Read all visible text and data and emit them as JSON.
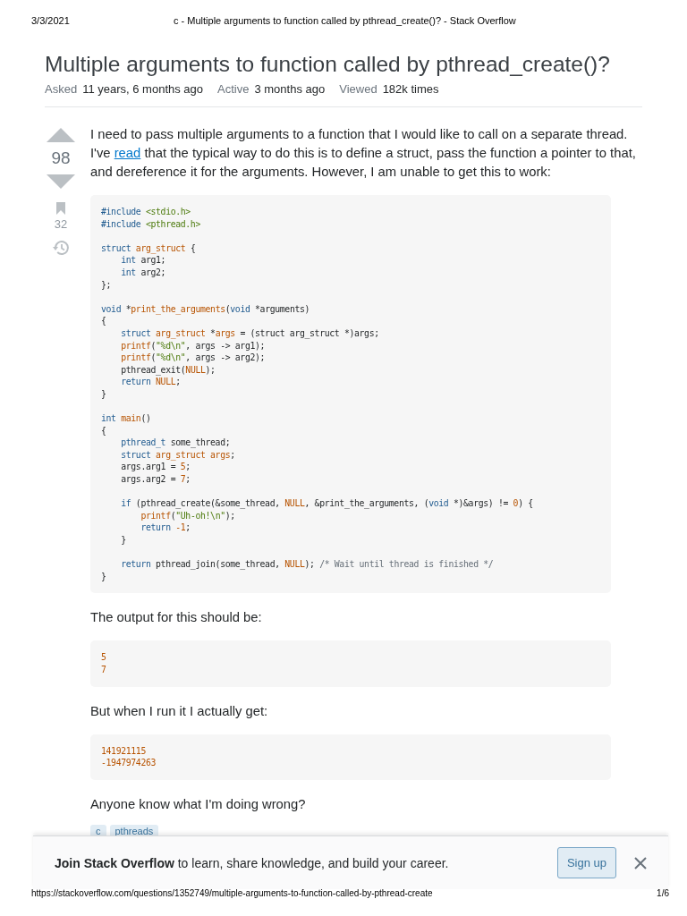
{
  "print_header": {
    "date": "3/3/2021",
    "page_title": "c - Multiple arguments to function called by pthread_create()? - Stack Overflow"
  },
  "question": {
    "title": "Multiple arguments to function called by pthread_create()?",
    "meta": [
      {
        "label": "Asked",
        "value": "11 years, 6 months ago"
      },
      {
        "label": "Active",
        "value": "3 months ago"
      },
      {
        "label": "Viewed",
        "value": "182k times"
      }
    ],
    "votes": "98",
    "bookmarks": "32",
    "body": [
      {
        "kind": "paragraph",
        "parts": [
          {
            "text": "I need to pass multiple arguments to a function that I would like to call on a separate thread. I've "
          },
          {
            "text": "read",
            "link": true
          },
          {
            "text": " that the typical way to do this is to define a struct, pass the function a pointer to that, and dereference it for the arguments. However, I am unable to get this to work:"
          }
        ]
      },
      {
        "kind": "code",
        "lines": [
          {
            "kind": "code",
            "tokens": [
              {
                "kind": "keyword",
                "text": "#include"
              },
              {
                "kind": "string",
                "text": " <stdio.h>"
              }
            ]
          },
          {
            "kind": "code",
            "tokens": [
              {
                "kind": "keyword",
                "text": "#include"
              },
              {
                "kind": "string",
                "text": " <pthread.h>"
              }
            ]
          },
          {
            "kind": "blank"
          },
          {
            "kind": "code",
            "tokens": [
              {
                "kind": "keyword",
                "text": "struct"
              },
              {
                "kind": "name",
                "text": " arg_struct"
              },
              {
                "kind": "plain",
                "text": " {"
              }
            ]
          },
          {
            "kind": "code",
            "tokens": [
              {
                "kind": "keyword",
                "text": "    int"
              },
              {
                "kind": "plain",
                "text": " arg1;"
              }
            ]
          },
          {
            "kind": "code",
            "tokens": [
              {
                "kind": "keyword",
                "text": "    int"
              },
              {
                "kind": "plain",
                "text": " arg2;"
              }
            ]
          },
          {
            "kind": "code",
            "tokens": [
              {
                "kind": "plain",
                "text": "};"
              }
            ]
          },
          {
            "kind": "blank"
          },
          {
            "kind": "code",
            "tokens": [
              {
                "kind": "keyword",
                "text": "void"
              },
              {
                "kind": "plain",
                "text": " *"
              },
              {
                "kind": "name",
                "text": "print_the_arguments"
              },
              {
                "kind": "plain",
                "text": "("
              },
              {
                "kind": "keyword",
                "text": "void"
              },
              {
                "kind": "plain",
                "text": " *arguments)"
              }
            ]
          },
          {
            "kind": "code",
            "tokens": [
              {
                "kind": "plain",
                "text": "{"
              }
            ]
          },
          {
            "kind": "code",
            "tokens": [
              {
                "kind": "keyword",
                "text": "    struct"
              },
              {
                "kind": "name",
                "text": " arg_struct"
              },
              {
                "kind": "plain",
                "text": " *"
              },
              {
                "kind": "name",
                "text": "args"
              },
              {
                "kind": "plain",
                "text": " = (struct arg_struct *)args;"
              }
            ]
          },
          {
            "kind": "code",
            "tokens": [
              {
                "kind": "name",
                "text": "    printf"
              },
              {
                "kind": "plain",
                "text": "("
              },
              {
                "kind": "string",
                "text": "\"%d\\n\""
              },
              {
                "kind": "plain",
                "text": ", args -> arg1);"
              }
            ]
          },
          {
            "kind": "code",
            "tokens": [
              {
                "kind": "name",
                "text": "    printf"
              },
              {
                "kind": "plain",
                "text": "("
              },
              {
                "kind": "string",
                "text": "\"%d\\n\""
              },
              {
                "kind": "plain",
                "text": ", args -> arg2);"
              }
            ]
          },
          {
            "kind": "code",
            "tokens": [
              {
                "kind": "plain",
                "text": "    pthread_exit("
              },
              {
                "kind": "name",
                "text": "NULL"
              },
              {
                "kind": "plain",
                "text": ");"
              }
            ]
          },
          {
            "kind": "code",
            "tokens": [
              {
                "kind": "keyword",
                "text": "    return"
              },
              {
                "kind": "name",
                "text": " NULL"
              },
              {
                "kind": "plain",
                "text": ";"
              }
            ]
          },
          {
            "kind": "code",
            "tokens": [
              {
                "kind": "plain",
                "text": "}"
              }
            ]
          },
          {
            "kind": "blank"
          },
          {
            "kind": "code",
            "tokens": [
              {
                "kind": "keyword",
                "text": "int"
              },
              {
                "kind": "name",
                "text": " main"
              },
              {
                "kind": "plain",
                "text": "()"
              }
            ]
          },
          {
            "kind": "code",
            "tokens": [
              {
                "kind": "plain",
                "text": "{"
              }
            ]
          },
          {
            "kind": "code",
            "tokens": [
              {
                "kind": "keyword",
                "text": "    pthread_t"
              },
              {
                "kind": "plain",
                "text": " some_thread;"
              }
            ]
          },
          {
            "kind": "code",
            "tokens": [
              {
                "kind": "keyword",
                "text": "    struct"
              },
              {
                "kind": "name",
                "text": " arg_struct"
              },
              {
                "kind": "name",
                "text": " args"
              },
              {
                "kind": "plain",
                "text": ";"
              }
            ]
          },
          {
            "kind": "code",
            "tokens": [
              {
                "kind": "plain",
                "text": "    args.arg1 = "
              },
              {
                "kind": "number",
                "text": "5"
              },
              {
                "kind": "plain",
                "text": ";"
              }
            ]
          },
          {
            "kind": "code",
            "tokens": [
              {
                "kind": "plain",
                "text": "    args.arg2 = "
              },
              {
                "kind": "number",
                "text": "7"
              },
              {
                "kind": "plain",
                "text": ";"
              }
            ]
          },
          {
            "kind": "blank"
          },
          {
            "kind": "code",
            "tokens": [
              {
                "kind": "keyword",
                "text": "    if"
              },
              {
                "kind": "plain",
                "text": " (pthread_create(&some_thread, "
              },
              {
                "kind": "name",
                "text": "NULL"
              },
              {
                "kind": "plain",
                "text": ", &print_the_arguments, ("
              },
              {
                "kind": "keyword",
                "text": "void"
              },
              {
                "kind": "plain",
                "text": " *)&args) != "
              },
              {
                "kind": "number",
                "text": "0"
              },
              {
                "kind": "plain",
                "text": ") {"
              }
            ]
          },
          {
            "kind": "code",
            "tokens": [
              {
                "kind": "name",
                "text": "        printf"
              },
              {
                "kind": "plain",
                "text": "("
              },
              {
                "kind": "string",
                "text": "\"Uh-oh!\\n\""
              },
              {
                "kind": "plain",
                "text": ");"
              }
            ]
          },
          {
            "kind": "code",
            "tokens": [
              {
                "kind": "keyword",
                "text": "        return"
              },
              {
                "kind": "number",
                "text": " -1"
              },
              {
                "kind": "plain",
                "text": ";"
              }
            ]
          },
          {
            "kind": "code",
            "tokens": [
              {
                "kind": "plain",
                "text": "    }"
              }
            ]
          },
          {
            "kind": "blank"
          },
          {
            "kind": "code",
            "tokens": [
              {
                "kind": "keyword",
                "text": "    return"
              },
              {
                "kind": "plain",
                "text": " pthread_join(some_thread, "
              },
              {
                "kind": "name",
                "text": "NULL"
              },
              {
                "kind": "plain",
                "text": "); "
              },
              {
                "kind": "comment",
                "text": "/* Wait until thread is finished */"
              }
            ]
          },
          {
            "kind": "code",
            "tokens": [
              {
                "kind": "plain",
                "text": "}"
              }
            ]
          }
        ]
      },
      {
        "kind": "paragraph",
        "parts": [
          {
            "text": "The output for this should be:"
          }
        ]
      },
      {
        "kind": "code",
        "lines": [
          {
            "kind": "code",
            "tokens": [
              {
                "kind": "number",
                "text": "5"
              }
            ]
          },
          {
            "kind": "code",
            "tokens": [
              {
                "kind": "number",
                "text": "7"
              }
            ]
          }
        ]
      },
      {
        "kind": "paragraph",
        "parts": [
          {
            "text": "But when I run it I actually get:"
          }
        ]
      },
      {
        "kind": "code",
        "lines": [
          {
            "kind": "code",
            "tokens": [
              {
                "kind": "number",
                "text": "141921115"
              }
            ]
          },
          {
            "kind": "code",
            "tokens": [
              {
                "kind": "number",
                "text": "-1947974263"
              }
            ]
          }
        ]
      },
      {
        "kind": "paragraph",
        "parts": [
          {
            "text": "Anyone know what I'm doing wrong?"
          }
        ]
      }
    ],
    "tags": [
      "c",
      "pthreads"
    ]
  },
  "banner": {
    "bold": "Join Stack Overflow",
    "text": " to learn, share knowledge, and build your career.",
    "button": "Sign up"
  },
  "print_footer": {
    "url": "https://stackoverflow.com/questions/1352749/multiple-arguments-to-function-called-by-pthread-create",
    "page": "1/6"
  }
}
